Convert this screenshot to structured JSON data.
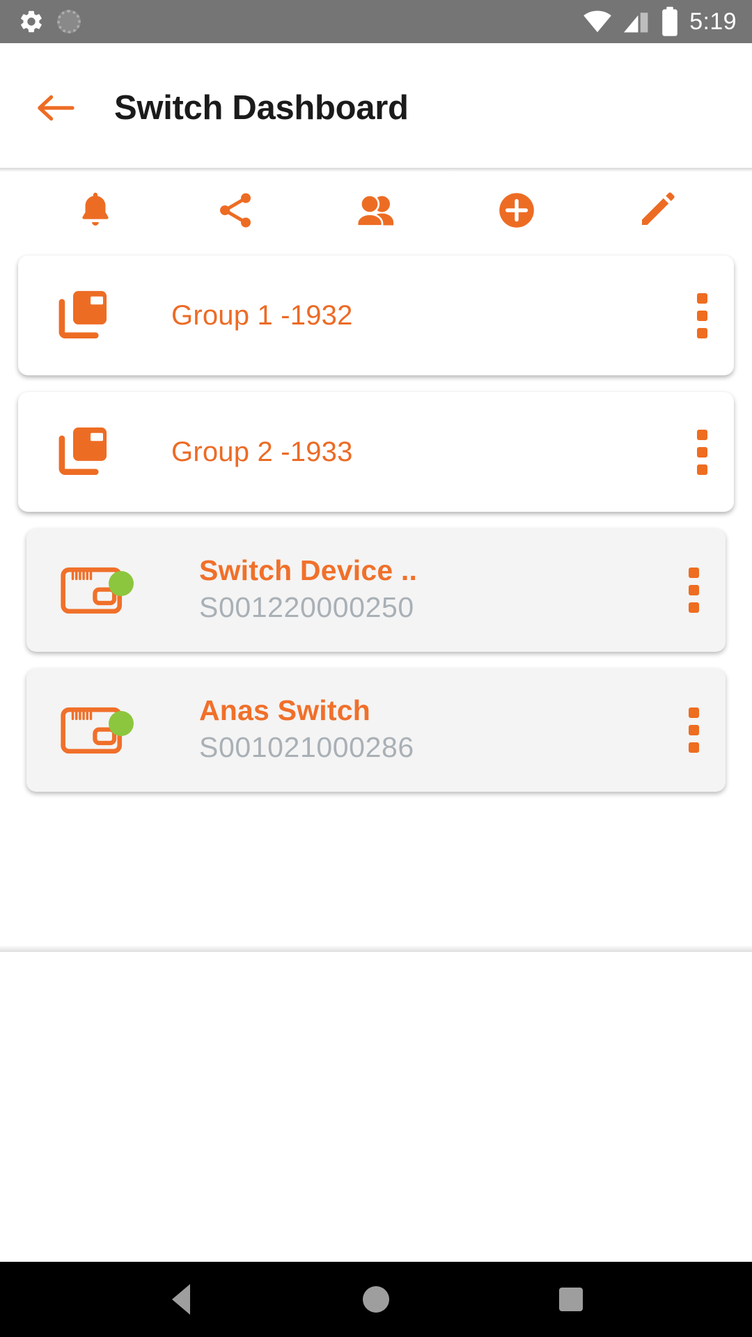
{
  "statusbar": {
    "time": "5:19",
    "icons": [
      "settings-gear-icon",
      "sync-icon",
      "wifi-icon",
      "cellular-signal-icon",
      "battery-icon"
    ]
  },
  "appbar": {
    "back_icon": "back-arrow-icon",
    "title": "Switch Dashboard"
  },
  "toolbar": {
    "items": [
      {
        "name": "notifications",
        "icon": "bell-icon"
      },
      {
        "name": "share",
        "icon": "share-icon"
      },
      {
        "name": "members",
        "icon": "people-icon"
      },
      {
        "name": "add",
        "icon": "plus-circle-icon"
      },
      {
        "name": "edit",
        "icon": "pencil-icon"
      }
    ]
  },
  "list": {
    "items": [
      {
        "type": "group",
        "icon": "group-layers-icon",
        "title": "Group 1  -1932",
        "subtitle": "",
        "status": "",
        "menu_icon": "more-vertical-icon"
      },
      {
        "type": "group",
        "icon": "group-layers-icon",
        "title": "Group 2  -1933",
        "subtitle": "",
        "status": "",
        "menu_icon": "more-vertical-icon"
      },
      {
        "type": "device",
        "icon": "switch-device-icon",
        "title": "Switch Device  ..",
        "subtitle": "S001220000250",
        "status": "online",
        "menu_icon": "more-vertical-icon"
      },
      {
        "type": "device",
        "icon": "switch-device-icon",
        "title": "Anas Switch",
        "subtitle": "S001021000286",
        "status": "online",
        "menu_icon": "more-vertical-icon"
      }
    ]
  },
  "navbar": {
    "back_icon": "nav-back-icon",
    "home_icon": "nav-home-icon",
    "recents_icon": "nav-recents-icon"
  },
  "colors": {
    "accent": "#ED6C24",
    "accent_light": "#F0702A",
    "status_online": "#8CC63E",
    "subtitle": "#A9B0B6",
    "statusbar_bg": "#757575",
    "navbar_bg": "#000000",
    "device_card_bg": "#F4F4F4",
    "group_card_bg": "#FFFFFF"
  }
}
